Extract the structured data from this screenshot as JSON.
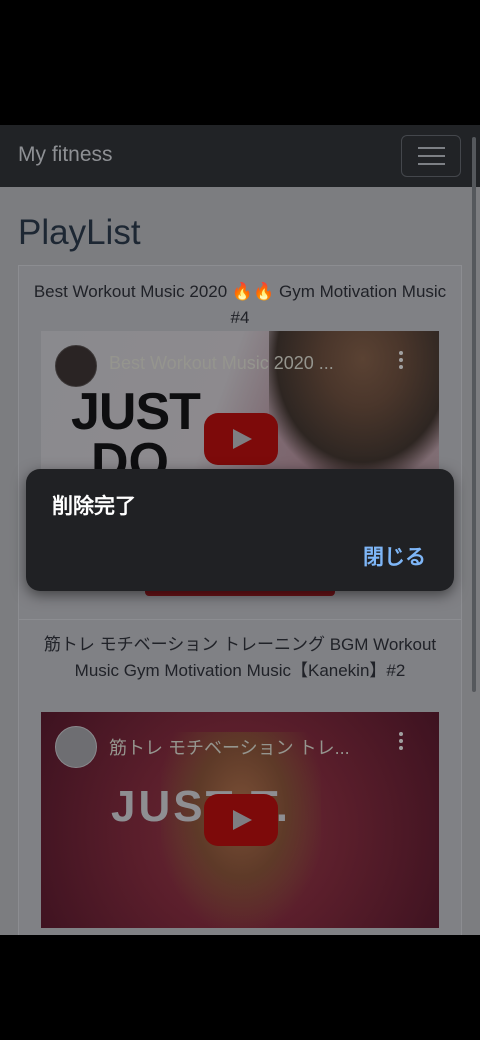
{
  "navbar": {
    "brand": "My fitness",
    "toggle_icon": "hamburger-menu-icon"
  },
  "page_title": "PlayList",
  "playlist": [
    {
      "title": "Best Workout Music 2020 🔥🔥 Gym Motivation Music #4",
      "video_title": "Best Workout Music 2020 ...",
      "thumbnail_text": "JUST DO"
    },
    {
      "title": "筋トレ モチベーション トレーニング BGM Workout Music Gym Motivation Music【Kanekin】#2",
      "video_title": "筋トレ モチベーション トレ...",
      "thumbnail_text": "JUST  T."
    }
  ],
  "dialog": {
    "message": "削除完了",
    "close_label": "閉じる"
  },
  "colors": {
    "navbar": "#212326",
    "dialog": "#202124",
    "dialog_action": "#7eb6f7",
    "delete_button": "#dc3545"
  }
}
